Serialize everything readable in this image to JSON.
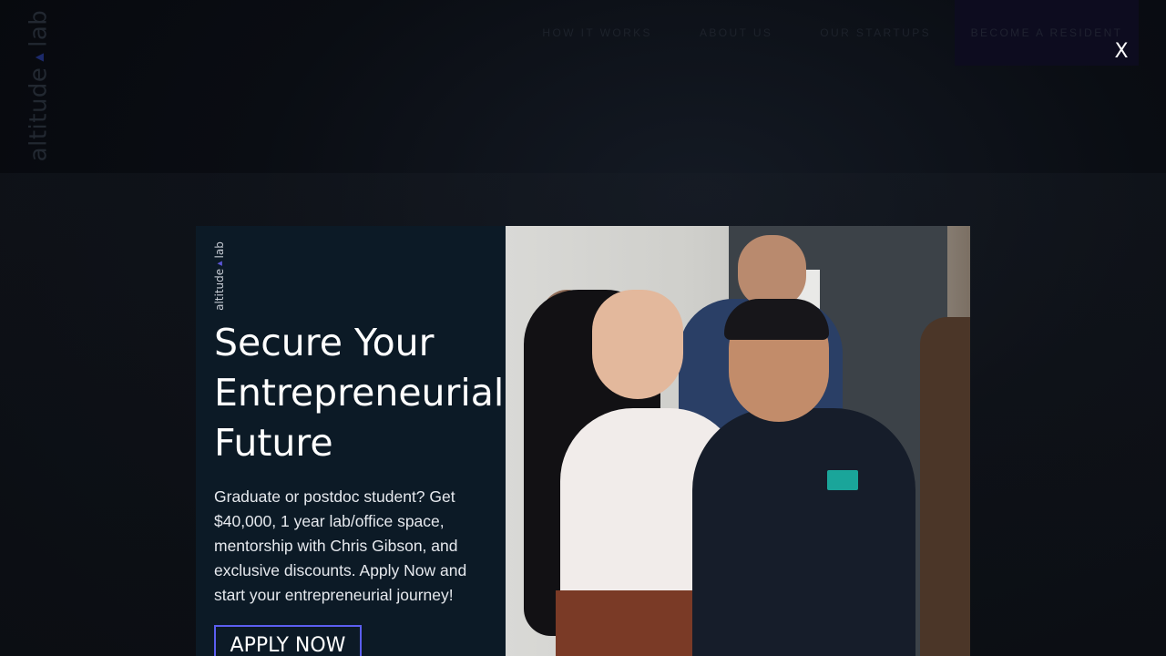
{
  "site": {
    "logo_text_left": "altitude",
    "logo_text_right": "lab"
  },
  "nav": {
    "items": [
      {
        "label": "HOW IT WORKS"
      },
      {
        "label": "ABOUT US"
      },
      {
        "label": "OUR STARTUPS"
      }
    ],
    "cta": "BECOME A RESIDENT"
  },
  "modal": {
    "close": "X",
    "logo_text_left": "altitude",
    "logo_text_right": "lab",
    "title_lines": [
      "Secure Your",
      "Entrepreneurial",
      "Future"
    ],
    "description": "Graduate or postdoc student? Get $40,000, 1 year lab/office space, mentorship with Chris Gibson, and exclusive discounts. Apply Now and start your entrepreneurial journey!",
    "apply_label": "APPLY NOW"
  },
  "colors": {
    "accent": "#5b5ef0",
    "modal_panel": "#0c1a26"
  }
}
